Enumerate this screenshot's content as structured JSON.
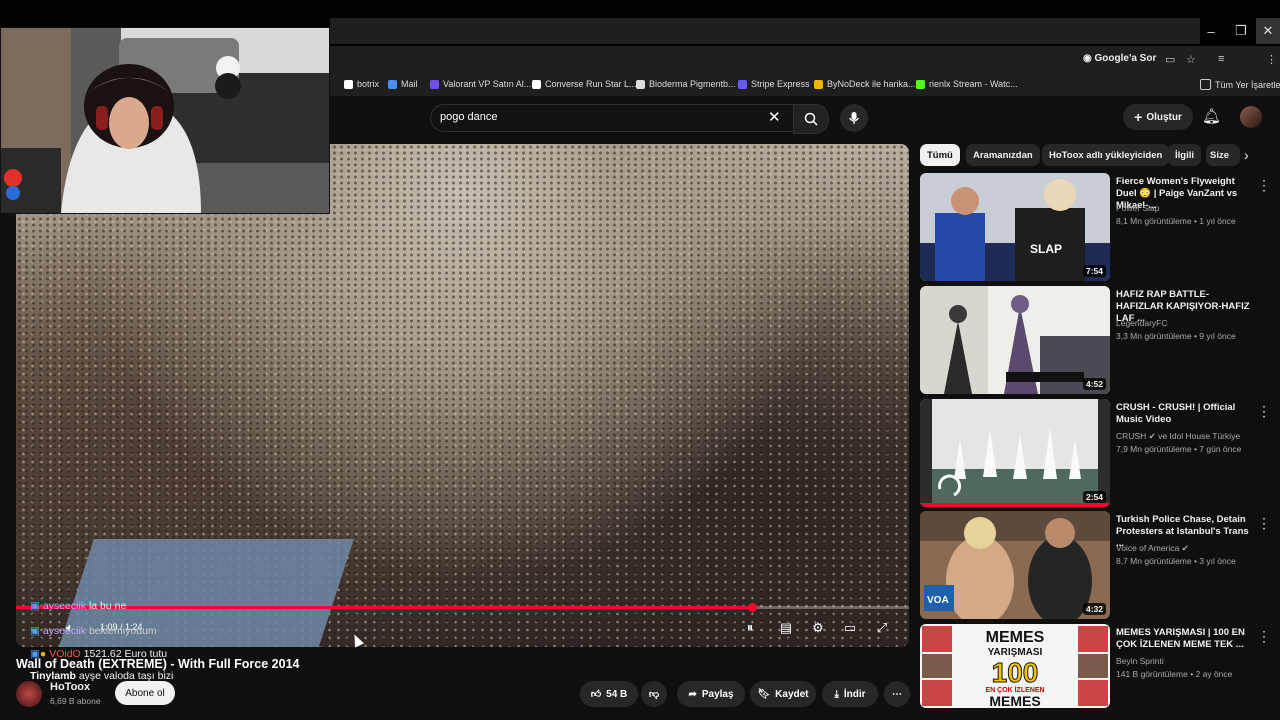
{
  "colors": {
    "accent": "#ff0033",
    "background": "#0f0f0f",
    "chip_bg": "#272727"
  },
  "bookmarks": [
    "botrix",
    "Mail",
    "Valorant VP Satın Al...",
    "Converse Run Star L...",
    "Bioderma Pigmentb...",
    "Stripe Express",
    "ByNoDeck ile harika...",
    "rienlx Stream - Watc...",
    "Tüm Yer İşaretleri"
  ],
  "browser": {
    "google_sor": "Google'a Sor"
  },
  "header": {
    "search_value": "pogo dance",
    "create_label": "Oluştur"
  },
  "player": {
    "time": "1:09 / 1:24",
    "progress": 0.824
  },
  "chat": [
    {
      "name": "ayseeciik",
      "text": "la bu ne"
    },
    {
      "name": "ayseeciik",
      "text": "beklemiyodum"
    },
    {
      "name": "VOidO",
      "text": "1521.62 Euro tutu"
    },
    {
      "name": "Tinylamb",
      "text": "ayşe valoda taşı bizi"
    }
  ],
  "video": {
    "title": "Wall of Death (EXTREME) - With Full Force 2014",
    "channel": "HoToox",
    "subs": "6,69 B abone",
    "subscribe": "Abone ol",
    "likes": "54 B",
    "share": "Paylaş",
    "save": "Kaydet",
    "download": "İndir"
  },
  "chips": [
    "Tümü",
    "Aramanızdan",
    "HoToox adlı yükleyiciden",
    "İlgili",
    "Size"
  ],
  "recommendations": [
    {
      "title": "Fierce Women's Flyweight Duel 😳 | Paige VanZant vs Mikael-...",
      "channel": "Power Slap",
      "meta": "8,1 Mn görüntüleme • 1 yıl önce",
      "duration": "7:54"
    },
    {
      "title": "HAFIZ RAP BATTLE-HAFIZLAR KAPIŞIYOR-HAFIZ LAF ...",
      "channel": "LegendaryFC",
      "meta": "3,3 Mn görüntüleme • 9 yıl önce",
      "duration": "4:52"
    },
    {
      "title": "CRUSH - CRUSH! | Official Music Video",
      "channel": "CRUSH ✔ ve Idol House Türkiye",
      "meta": "7,9 Mn görüntüleme • 7 gün önce",
      "duration": "2:54"
    },
    {
      "title": "Turkish Police Chase, Detain Protesters at Istanbul's Trans ...",
      "channel": "Voice of America ✔",
      "meta": "8,7 Mn görüntüleme • 3 yıl önce",
      "duration": "4:32"
    },
    {
      "title": "MEMES YARIŞMASI | 100 EN ÇOK İZLENEN MEME TEK ...",
      "channel": "Beyin Sprinti",
      "meta": "141 B görüntüleme • 2 ay önce",
      "duration": ""
    }
  ],
  "thumb_text": {
    "memes": "MEMES",
    "yarismasi": "YARIŞMASI",
    "hundred": "100",
    "en_cok": "EN ÇOK İZLENEN",
    "memes2": "MEMES",
    "voa": "VOA",
    "slap": "SLAP"
  }
}
